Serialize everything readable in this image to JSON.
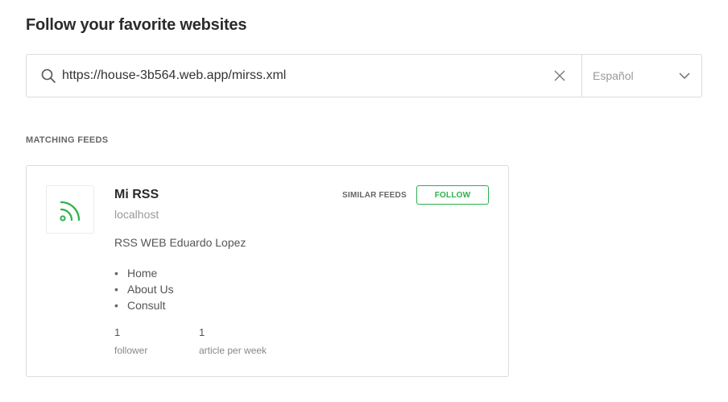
{
  "page": {
    "title": "Follow your favorite websites"
  },
  "search": {
    "value": "https://house-3b564.web.app/mirss.xml",
    "language": "Español"
  },
  "section": {
    "label": "MATCHING FEEDS"
  },
  "feed": {
    "title": "Mi RSS",
    "domain": "localhost",
    "description": "RSS WEB Eduardo Lopez",
    "similar_label": "SIMILAR FEEDS",
    "follow_label": "FOLLOW",
    "links": [
      "Home",
      "About Us",
      "Consult"
    ],
    "stats": [
      {
        "value": "1",
        "label": "follower"
      },
      {
        "value": "1",
        "label": "article per week"
      }
    ]
  },
  "icons": {
    "search": "search-icon",
    "clear": "close-icon",
    "dropdown": "chevron-down-icon",
    "feed_logo": "rss-icon"
  },
  "colors": {
    "accent": "#2bb24c",
    "border": "#dcdcdc",
    "title": "#2b2b2b"
  }
}
